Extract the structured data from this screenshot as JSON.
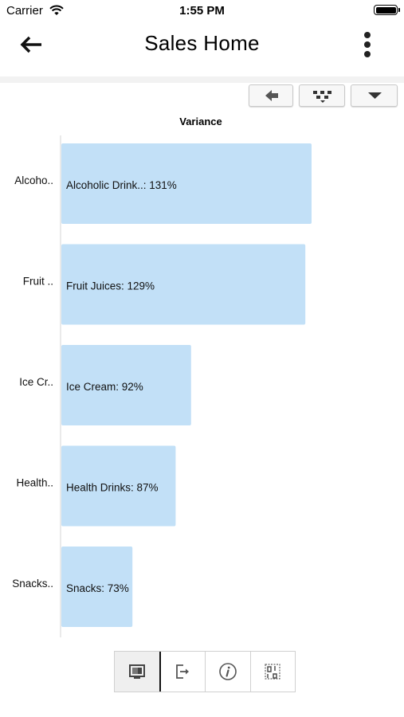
{
  "status_bar": {
    "carrier": "Carrier",
    "time": "1:55 PM"
  },
  "nav": {
    "title": "Sales Home"
  },
  "chart_data": {
    "type": "bar",
    "orientation": "horizontal",
    "title": "Variance",
    "categories": [
      "Alcoho..",
      "Fruit ..",
      "Ice Cr..",
      "Health..",
      "Snacks.."
    ],
    "labels": [
      "Alcoholic Drink..: 131%",
      "Fruit Juices: 129%",
      "Ice Cream: 92%",
      "Health Drinks: 87%",
      "Snacks: 73%"
    ],
    "values": [
      131,
      129,
      92,
      87,
      73
    ],
    "value_unit": "%",
    "xlim": [
      50,
      140
    ],
    "color": "#c2e0f7",
    "grid": false
  },
  "bottom_tabs": [
    {
      "icon": "chart-view-icon",
      "active": true
    },
    {
      "icon": "export-icon",
      "active": false
    },
    {
      "icon": "info-icon",
      "active": false
    },
    {
      "icon": "data-view-icon",
      "active": false
    }
  ]
}
